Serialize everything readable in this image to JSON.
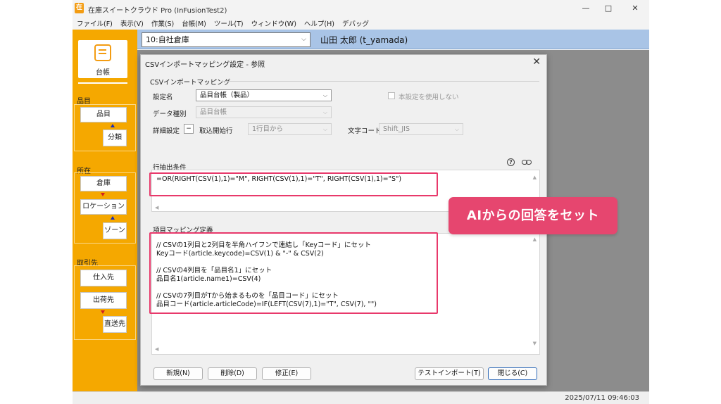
{
  "window": {
    "title": "在庫スイートクラウド Pro (InFusionTest2)",
    "app_icon_glyph": "在",
    "controls": {
      "minimize": "—",
      "maximize": "□",
      "close": "✕"
    }
  },
  "menu": [
    "ファイル(F)",
    "表示(V)",
    "作業(S)",
    "台帳(M)",
    "ツール(T)",
    "ウィンドウ(W)",
    "ヘルプ(H)",
    "デバッグ"
  ],
  "toolbar": {
    "warehouse": "10:自社倉庫",
    "user": "山田 太郎 (t_yamada)"
  },
  "sidebar": {
    "ledger_label": "台帳",
    "groups": [
      {
        "label": "品目",
        "buttons": [
          "品目",
          "分類"
        ]
      },
      {
        "label": "所在",
        "buttons": [
          "倉庫",
          "ロケーション",
          "ゾーン"
        ]
      },
      {
        "label": "取引先",
        "buttons": [
          "仕入先",
          "出荷先",
          "直送先"
        ]
      }
    ]
  },
  "dialog": {
    "title": "CSVインポートマッピング設定 - 参照",
    "close": "✕",
    "section_mapping": "CSVインポートマッピング",
    "labels": {
      "setting_name": "設定名",
      "data_type": "データ種別",
      "detail": "詳細設定",
      "detail_button": "−",
      "start_row": "取込開始行",
      "encoding": "文字コード",
      "unused": "本設定を使用しない"
    },
    "values": {
      "setting_name": "品目台帳（製品）",
      "data_type": "品目台帳",
      "start_row": "1行目から",
      "encoding": "Shift_JIS"
    },
    "row_filter": {
      "label": "行抽出条件",
      "help": "?",
      "expression": "=OR(RIGHT(CSV(1),1)=\"M\", RIGHT(CSV(1),1)=\"T\", RIGHT(CSV(1),1)=\"S\")"
    },
    "mapping": {
      "label": "項目マッピング定義",
      "lines": [
        "// CSVの1列目と2列目を半角ハイフンで連結し「Keyコード」にセット",
        "Keyコード(article.keycode)=CSV(1) & \"-\" & CSV(2)",
        "",
        "// CSVの4列目を「品目名1」にセット",
        "品目名1(article.name1)=CSV(4)",
        "",
        "// CSVの7列目がTから始まるものを「品目コード」にセット",
        "品目コード(article.articleCode)=IF(LEFT(CSV(7),1)=\"T\", CSV(7), \"\")"
      ]
    },
    "buttons": {
      "new": "新規(N)",
      "delete": "削除(D)",
      "edit": "修正(E)",
      "test_import": "テストインポート(T)",
      "close": "閉じる(C)"
    }
  },
  "status": {
    "datetime": "2025/07/11  09:46:03"
  },
  "callout": {
    "text": "AIからの回答をセット"
  },
  "colors": {
    "sidebar": "#f5a800",
    "toolbar": "#a9c4e6",
    "highlight": "#e8396b",
    "callout": "#e6466f",
    "up_arrow": "#1a2db8",
    "down_arrow": "#d21f1f"
  }
}
